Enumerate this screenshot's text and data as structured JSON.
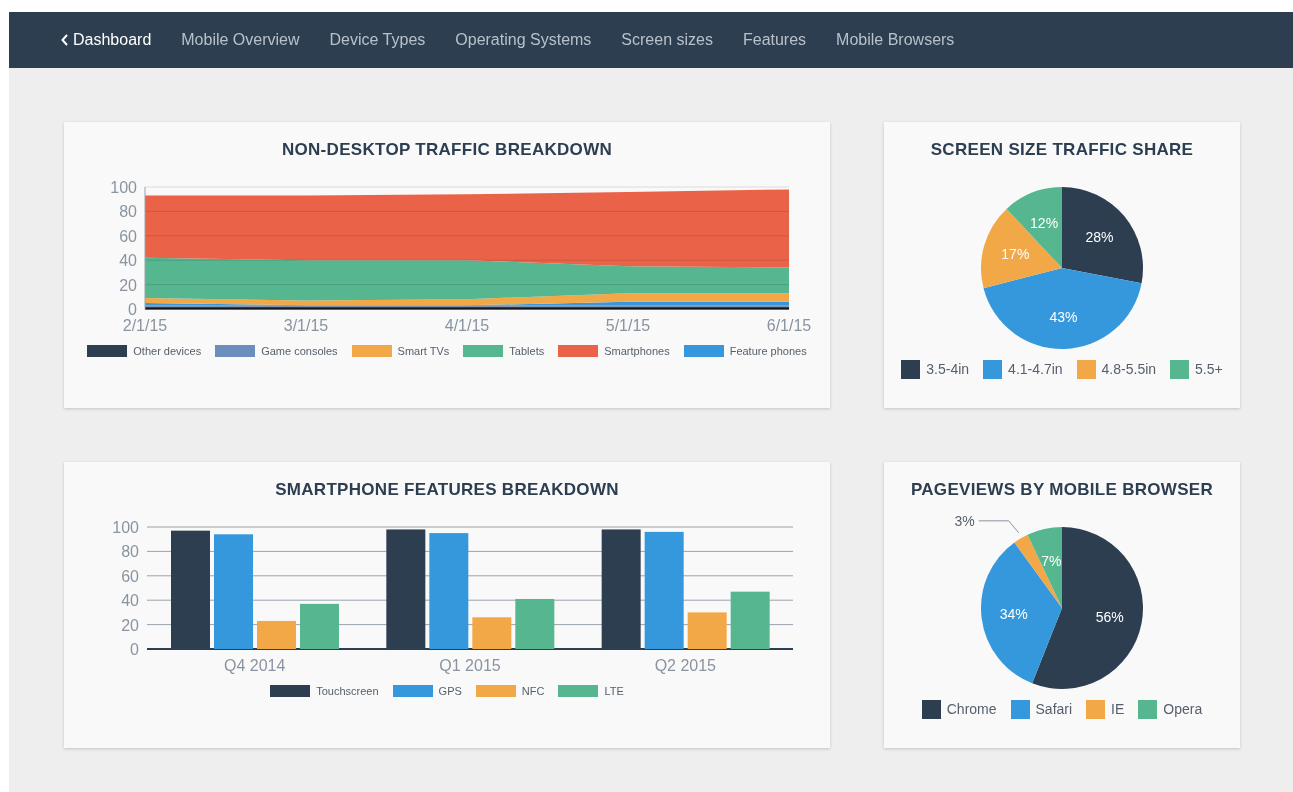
{
  "nav": {
    "back": {
      "label": "Dashboard"
    },
    "items": [
      {
        "label": "Mobile Overview",
        "selected": false
      },
      {
        "label": "Device Types",
        "selected": false
      },
      {
        "label": "Operating Systems",
        "selected": false
      },
      {
        "label": "Screen sizes",
        "selected": false
      },
      {
        "label": "Features",
        "selected": false
      },
      {
        "label": "Mobile Browsers",
        "selected": false
      }
    ]
  },
  "traffic_card": {
    "title": "NON-DESKTOP TRAFFIC BREAKDOWN",
    "chart_data": {
      "type": "area",
      "stacked": true,
      "grid": true,
      "x": [
        "2/1/15",
        "3/1/15",
        "4/1/15",
        "5/1/15",
        "6/1/15"
      ],
      "ylim": [
        0,
        100
      ],
      "yticks": [
        0,
        20,
        40,
        60,
        80,
        100
      ],
      "series": [
        {
          "name": "Other devices",
          "color": "#2d3e50",
          "values": [
            2,
            2,
            2,
            2,
            2
          ]
        },
        {
          "name": "Game consoles",
          "color": "#6a8fbd",
          "values": [
            1,
            1,
            1,
            1,
            1
          ]
        },
        {
          "name": "Feature phones",
          "color": "#3598dc",
          "values": [
            2,
            0,
            0,
            3,
            3
          ]
        },
        {
          "name": "Smart TVs",
          "color": "#f3a847",
          "values": [
            4,
            4,
            5,
            7,
            7
          ]
        },
        {
          "name": "Tablets",
          "color": "#56b690",
          "values": [
            33,
            33,
            32,
            22,
            21
          ]
        },
        {
          "name": "Smartphones",
          "color": "#ea6348",
          "values": [
            51,
            53,
            54,
            61,
            64
          ]
        }
      ]
    }
  },
  "screen_card": {
    "title": "SCREEN SIZE TRAFFIC SHARE",
    "chart_data": {
      "type": "pie",
      "categories": [
        "3.5-4in",
        "4.1-4.7in",
        "4.8-5.5in",
        "5.5+"
      ],
      "values": [
        28,
        43,
        17,
        12
      ],
      "colors": [
        "#2d3e50",
        "#3598dc",
        "#f3a847",
        "#56b690"
      ],
      "value_labels": [
        "28%",
        "43%",
        "17%",
        "12%"
      ]
    }
  },
  "features_card": {
    "title": "SMARTPHONE FEATURES BREAKDOWN",
    "chart_data": {
      "type": "bar",
      "grid": true,
      "categories": [
        "Q4 2014",
        "Q1 2015",
        "Q2 2015"
      ],
      "ylim": [
        0,
        100
      ],
      "yticks": [
        0,
        20,
        40,
        60,
        80,
        100
      ],
      "series": [
        {
          "name": "Touchscreen",
          "color": "#2d3e50",
          "values": [
            97,
            98,
            98
          ]
        },
        {
          "name": "GPS",
          "color": "#3598dc",
          "values": [
            94,
            95,
            96
          ]
        },
        {
          "name": "NFC",
          "color": "#f3a847",
          "values": [
            23,
            26,
            30
          ]
        },
        {
          "name": "LTE",
          "color": "#56b690",
          "values": [
            37,
            41,
            47
          ]
        }
      ]
    }
  },
  "browser_card": {
    "title": "PAGEVIEWS BY MOBILE BROWSER",
    "chart_data": {
      "type": "pie",
      "categories": [
        "Chrome",
        "Safari",
        "IE",
        "Opera"
      ],
      "values": [
        56,
        34,
        3,
        7
      ],
      "colors": [
        "#2d3e50",
        "#3598dc",
        "#f3a847",
        "#56b690"
      ],
      "value_labels": [
        "56%",
        "34%",
        "3%",
        "7%"
      ]
    }
  }
}
